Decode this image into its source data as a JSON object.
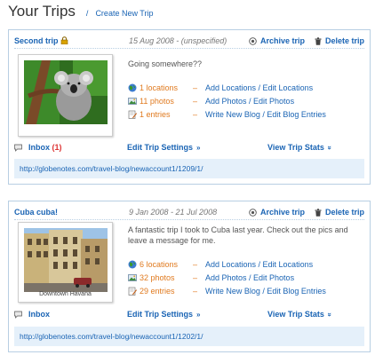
{
  "header": {
    "title": "Your Trips",
    "separator": "/",
    "create_link": "Create New Trip"
  },
  "trips": [
    {
      "name": "Second trip",
      "locked": true,
      "dates": "15 Aug 2008 - (unspecified)",
      "archive_label": "Archive trip",
      "delete_label": "Delete trip",
      "photo_caption": "",
      "description": "Going somewhere??",
      "stats": {
        "locations": {
          "count": "1 locations",
          "dash": "–",
          "link": "Add Locations / Edit Locations"
        },
        "photos": {
          "count": "11 photos",
          "dash": "–",
          "link": "Add Photos / Edit Photos"
        },
        "entries": {
          "count": "1 entries",
          "dash": "–",
          "link": "Write New Blog / Edit Blog Entries"
        }
      },
      "inbox_label": "Inbox",
      "inbox_count": "(1)",
      "settings_label": "Edit Trip Settings",
      "settings_chevron": "»",
      "stats_label": "View Trip Stats",
      "stats_chevron": "»",
      "url": "http://globenotes.com/travel-blog/newaccount1/1209/1/"
    },
    {
      "name": "Cuba cuba!",
      "locked": false,
      "dates": "9 Jan 2008 - 21 Jul 2008",
      "archive_label": "Archive trip",
      "delete_label": "Delete trip",
      "photo_caption": "Downtown Havana",
      "description": "A fantastic trip I took to Cuba last year. Check out the pics and leave a message for me.",
      "stats": {
        "locations": {
          "count": "6 locations",
          "dash": "–",
          "link": "Add Locations / Edit Locations"
        },
        "photos": {
          "count": "32 photos",
          "dash": "–",
          "link": "Add Photos / Edit Photos"
        },
        "entries": {
          "count": "29 entries",
          "dash": "–",
          "link": "Write New Blog / Edit Blog Entries"
        }
      },
      "inbox_label": "Inbox",
      "inbox_count": "",
      "settings_label": "Edit Trip Settings",
      "settings_chevron": "»",
      "stats_label": "View Trip Stats",
      "stats_chevron": "»",
      "url": "http://globenotes.com/travel-blog/newaccount1/1202/1/"
    }
  ],
  "colors": {
    "link_blue": "#1a64b4",
    "stat_orange": "#e07a1f",
    "card_border": "#b8cfe3",
    "url_bar_bg": "#e5f0fa",
    "inbox_count_red": "#dd3333"
  },
  "icons": {
    "lock": "lock-icon",
    "archive": "archive-icon",
    "delete": "trash-icon",
    "locations": "globe-icon",
    "photos": "photo-icon",
    "entries": "blog-icon",
    "inbox": "speech-bubble-icon"
  }
}
